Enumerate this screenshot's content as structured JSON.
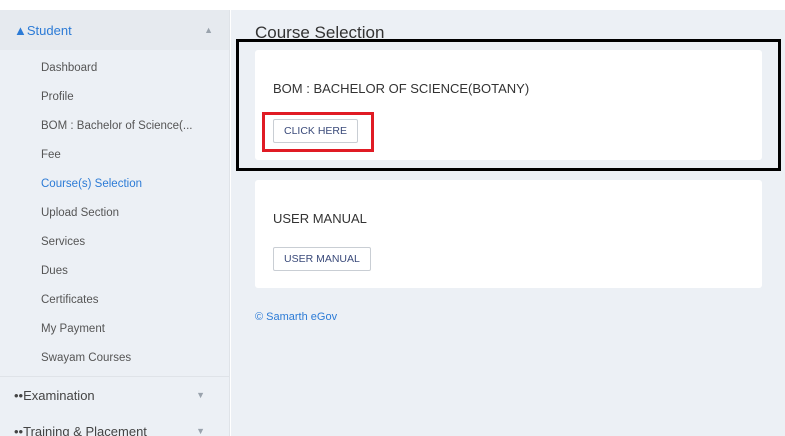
{
  "sidebar": {
    "student_section": {
      "label": "Student",
      "icon": "user-icon",
      "chevron": "up"
    },
    "items": [
      {
        "label": "Dashboard"
      },
      {
        "label": "Profile"
      },
      {
        "label": "BOM : Bachelor of Science(..."
      },
      {
        "label": "Fee"
      },
      {
        "label": "Course(s) Selection",
        "active": true
      },
      {
        "label": "Upload Section"
      },
      {
        "label": "Services"
      },
      {
        "label": "Dues"
      },
      {
        "label": "Certificates"
      },
      {
        "label": "My Payment"
      },
      {
        "label": "Swayam Courses"
      }
    ],
    "examination": {
      "label": "Examination",
      "icon": "group-icon"
    },
    "training": {
      "label": "Training & Placement",
      "icon": "group-icon"
    }
  },
  "main": {
    "title": "Course Selection",
    "card1": {
      "title": "BOM : BACHELOR OF SCIENCE(BOTANY)",
      "button": "CLICK HERE"
    },
    "card2": {
      "title": "USER MANUAL",
      "button": "USER MANUAL"
    },
    "footer": "© Samarth eGov"
  },
  "colors": {
    "accent": "#2c7bd6",
    "sidebar_bg": "#ecf0f5",
    "highlight_black": "#000000",
    "highlight_red": "#e01b24"
  }
}
